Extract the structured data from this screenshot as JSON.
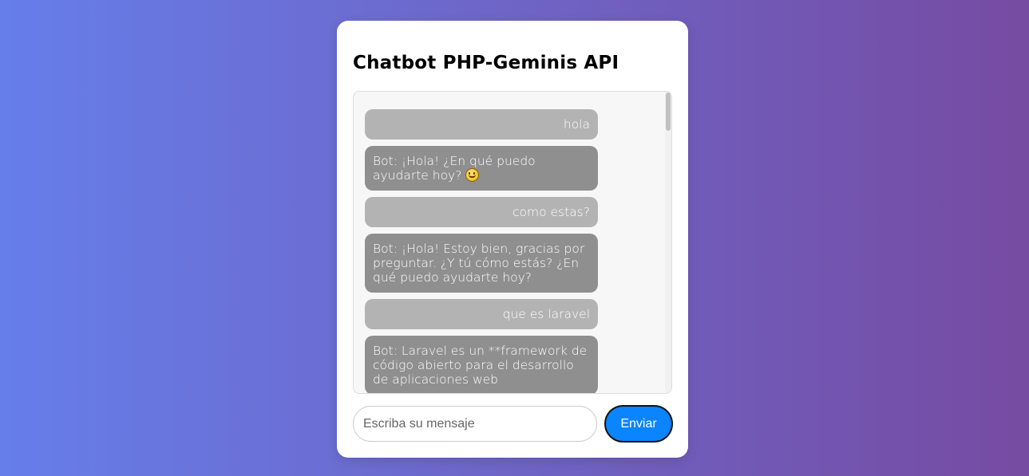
{
  "app": {
    "title": "Chatbot PHP-Geminis API"
  },
  "chat": {
    "messages": [
      {
        "role": "user",
        "text": "hola"
      },
      {
        "role": "bot",
        "text": "Bot: ¡Hola! ¿En qué puedo ayudarte hoy?",
        "emoji": "smiling-face-emoji"
      },
      {
        "role": "user",
        "text": "como estas?"
      },
      {
        "role": "bot",
        "text": "Bot: ¡Hola! Estoy bien, gracias por preguntar. ¿Y tú cómo estás? ¿En qué puedo ayudarte hoy?"
      },
      {
        "role": "user",
        "text": "que es laravel"
      },
      {
        "role": "bot",
        "text": "Bot: Laravel es un **framework de código abierto para el desarrollo de aplicaciones web"
      }
    ]
  },
  "composer": {
    "placeholder": "Escriba su mensaje",
    "value": "",
    "send_label": "Enviar"
  },
  "colors": {
    "background_start": "#667eea",
    "background_end": "#764ba2",
    "user_bubble": "#b3b3b3",
    "bot_bubble": "#8f8f8f",
    "send_button": "#0a84ff"
  }
}
